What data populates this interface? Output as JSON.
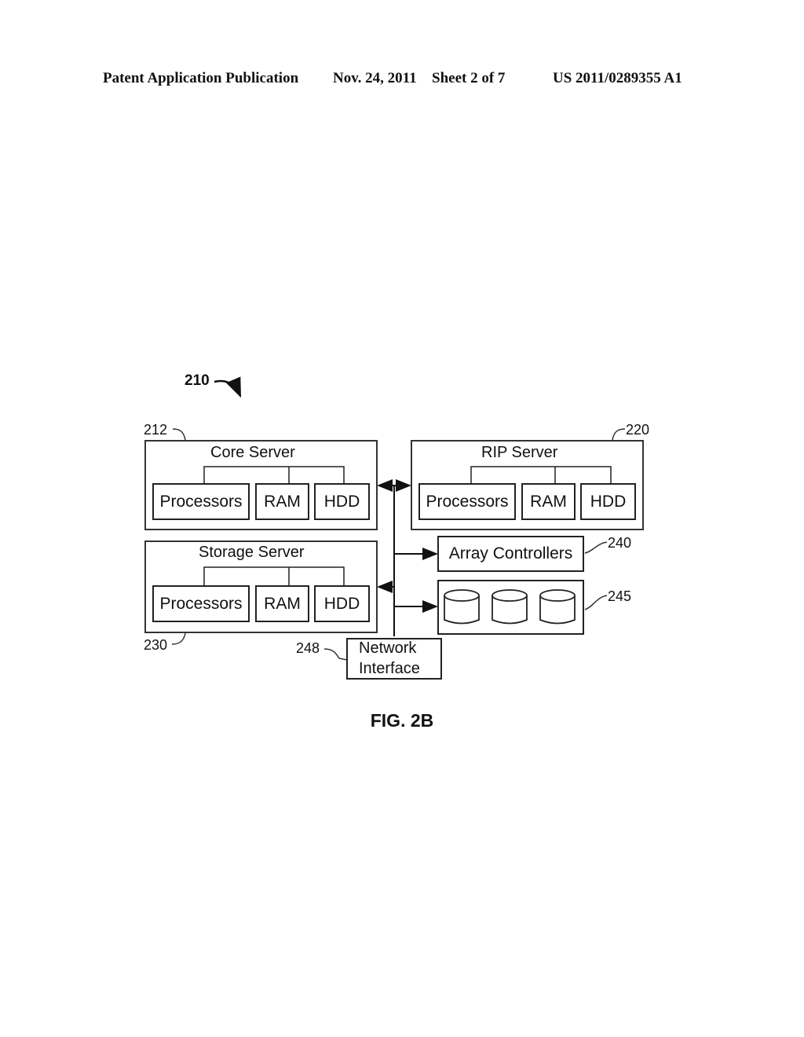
{
  "header": {
    "publication": "Patent Application Publication",
    "date": "Nov. 24, 2011",
    "sheet": "Sheet 2 of 7",
    "number": "US 2011/0289355 A1"
  },
  "figure": {
    "ref": "210",
    "caption": "FIG. 2B",
    "core_server": {
      "ref": "212",
      "title": "Core Server",
      "components": [
        "Processors",
        "RAM",
        "HDD"
      ]
    },
    "rip_server": {
      "ref": "220",
      "title": "RIP Server",
      "components": [
        "Processors",
        "RAM",
        "HDD"
      ]
    },
    "storage_server": {
      "ref": "230",
      "title": "Storage Server",
      "components": [
        "Processors",
        "RAM",
        "HDD"
      ]
    },
    "array_controllers": {
      "ref": "240",
      "title": "Array Controllers"
    },
    "disk_array": {
      "ref": "245",
      "disks": 3
    },
    "network_interface": {
      "ref": "248",
      "line1": "Network",
      "line2": "Interface"
    }
  }
}
